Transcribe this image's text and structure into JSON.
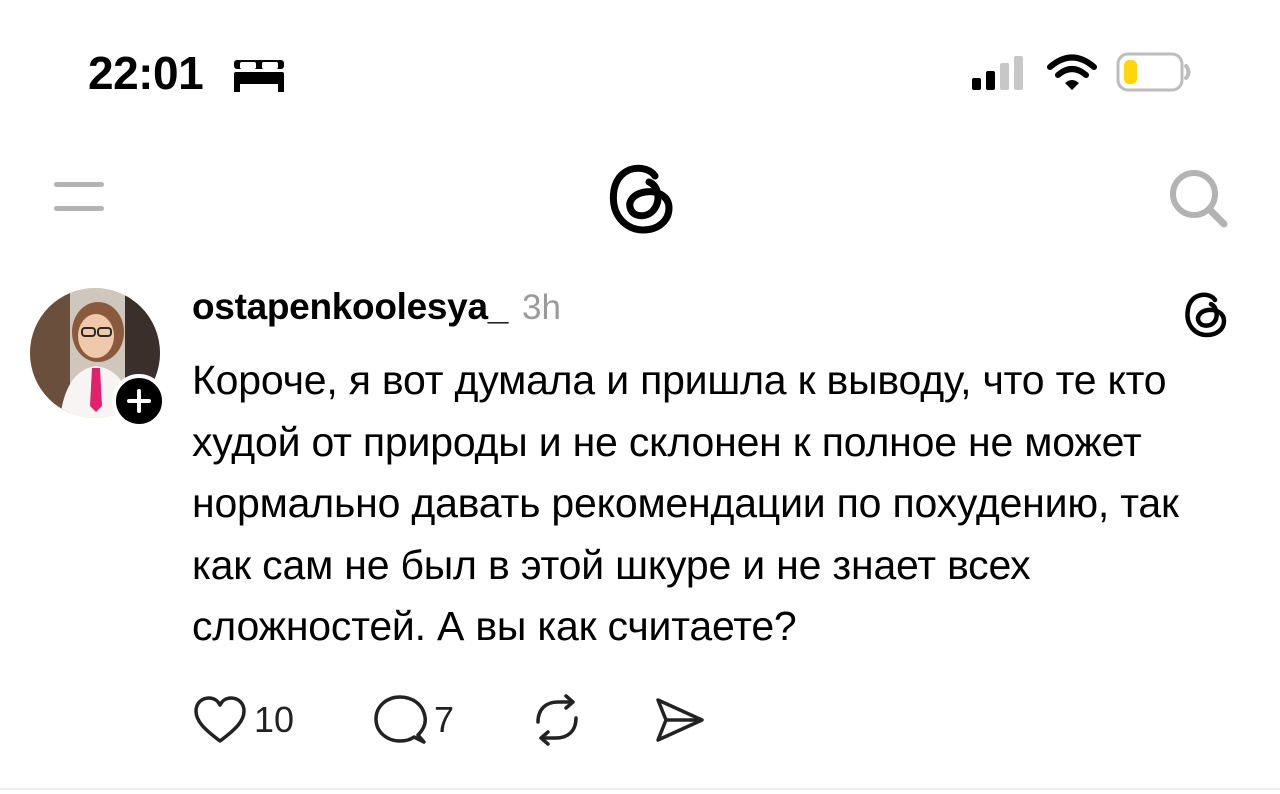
{
  "status_bar": {
    "time": "22:01",
    "focus_icon": "bed-icon",
    "signal_icon": "cellular-signal-icon",
    "wifi_icon": "wifi-icon",
    "battery_icon": "battery-low-icon",
    "battery_color": "#ffd60a"
  },
  "header": {
    "menu_icon": "menu-icon",
    "logo_icon": "threads-logo-icon",
    "search_icon": "search-icon"
  },
  "post": {
    "username": "ostapenkoolesya_",
    "time_ago": "3h",
    "avatar": "avatar",
    "follow_icon": "plus-icon",
    "source_icon": "threads-logo-icon",
    "body": "Короче, я вот думала и пришла к выводу, что те кто худой от природы и не склонен к полное не может нормально давать рекомендации по похудению, так как сам не был в этой шкуре и не знает всех сложностей. А вы как считаете?",
    "actions": {
      "likes": "10",
      "replies": "7",
      "like_icon": "heart-icon",
      "reply_icon": "comment-icon",
      "repost_icon": "repost-icon",
      "share_icon": "send-icon"
    }
  },
  "colors": {
    "text": "#000000",
    "muted": "#9a9a9a",
    "icon_gray": "#b3b3b3"
  }
}
